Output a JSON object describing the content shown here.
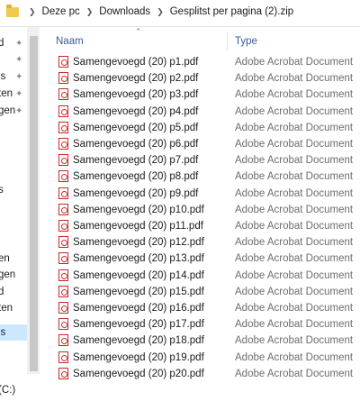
{
  "breadcrumb": {
    "items": [
      "Deze pc",
      "Downloads",
      "Gesplitst per pagina (2).zip"
    ]
  },
  "nav": {
    "items": [
      {
        "label": "d",
        "pinned": true
      },
      {
        "label": "",
        "pinned": true
      },
      {
        "label": "ls",
        "pinned": true
      },
      {
        "label": "ten",
        "pinned": true
      },
      {
        "label": "gen",
        "pinned": true
      },
      {
        "label": "s",
        "pinned": false
      },
      {
        "label": "en",
        "pinned": false
      },
      {
        "label": "gen",
        "pinned": false
      },
      {
        "label": "d",
        "pinned": false
      },
      {
        "label": "ten",
        "pinned": false
      },
      {
        "label": "ls",
        "pinned": false
      },
      {
        "label": "(C:)",
        "pinned": false
      }
    ]
  },
  "columns": {
    "name": "Naam",
    "type": "Type"
  },
  "files": [
    {
      "name": "Samengevoegd (20) p1.pdf",
      "type": "Adobe Acrobat Document"
    },
    {
      "name": "Samengevoegd (20) p2.pdf",
      "type": "Adobe Acrobat Document"
    },
    {
      "name": "Samengevoegd (20) p3.pdf",
      "type": "Adobe Acrobat Document"
    },
    {
      "name": "Samengevoegd (20) p4.pdf",
      "type": "Adobe Acrobat Document"
    },
    {
      "name": "Samengevoegd (20) p5.pdf",
      "type": "Adobe Acrobat Document"
    },
    {
      "name": "Samengevoegd (20) p6.pdf",
      "type": "Adobe Acrobat Document"
    },
    {
      "name": "Samengevoegd (20) p7.pdf",
      "type": "Adobe Acrobat Document"
    },
    {
      "name": "Samengevoegd (20) p8.pdf",
      "type": "Adobe Acrobat Document"
    },
    {
      "name": "Samengevoegd (20) p9.pdf",
      "type": "Adobe Acrobat Document"
    },
    {
      "name": "Samengevoegd (20) p10.pdf",
      "type": "Adobe Acrobat Document"
    },
    {
      "name": "Samengevoegd (20) p11.pdf",
      "type": "Adobe Acrobat Document"
    },
    {
      "name": "Samengevoegd (20) p12.pdf",
      "type": "Adobe Acrobat Document"
    },
    {
      "name": "Samengevoegd (20) p13.pdf",
      "type": "Adobe Acrobat Document"
    },
    {
      "name": "Samengevoegd (20) p14.pdf",
      "type": "Adobe Acrobat Document"
    },
    {
      "name": "Samengevoegd (20) p15.pdf",
      "type": "Adobe Acrobat Document"
    },
    {
      "name": "Samengevoegd (20) p16.pdf",
      "type": "Adobe Acrobat Document"
    },
    {
      "name": "Samengevoegd (20) p17.pdf",
      "type": "Adobe Acrobat Document"
    },
    {
      "name": "Samengevoegd (20) p18.pdf",
      "type": "Adobe Acrobat Document"
    },
    {
      "name": "Samengevoegd (20) p19.pdf",
      "type": "Adobe Acrobat Document"
    },
    {
      "name": "Samengevoegd (20) p20.pdf",
      "type": "Adobe Acrobat Document"
    }
  ],
  "icons": {
    "folder": "folder-icon",
    "pin": "pin-icon",
    "pdf": "pdf-file-icon"
  },
  "colors": {
    "selected": "#cce8ff",
    "header_text": "#3b5998",
    "pdf_red": "#d32f2f"
  }
}
